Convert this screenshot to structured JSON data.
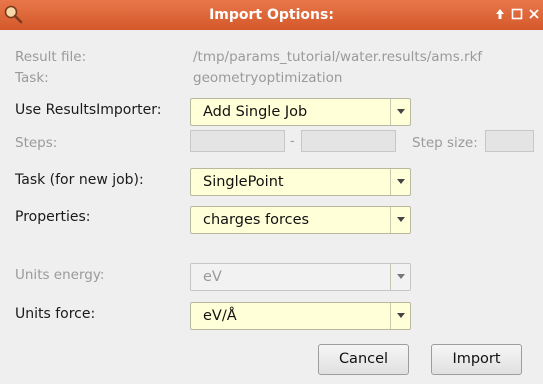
{
  "window": {
    "title": "Import Options:",
    "icon": "search-icon",
    "controls": [
      "pin-icon",
      "maximize-icon",
      "close-icon"
    ]
  },
  "info": {
    "result_file_label": "Result file:",
    "result_file_value": "/tmp/params_tutorial/water.results/ams.rkf",
    "task_label": "Task:",
    "task_value": "geometryoptimization"
  },
  "form": {
    "use_importer_label": "Use ResultsImporter:",
    "use_importer_value": "Add Single Job",
    "steps_label": "Steps:",
    "steps_sep": "-",
    "step_size_label": "Step size:",
    "task_new_label": "Task (for new job):",
    "task_new_value": "SinglePoint",
    "properties_label": "Properties:",
    "properties_value": "charges forces",
    "units_energy_label": "Units energy:",
    "units_energy_value": "eV",
    "units_force_label": "Units force:",
    "units_force_value": "eV/Å"
  },
  "buttons": {
    "cancel": "Cancel",
    "import": "Import"
  },
  "colors": {
    "titlebar": "#d9602f",
    "combo_bg": "#ffffd8",
    "dialog_bg": "#efefef"
  }
}
